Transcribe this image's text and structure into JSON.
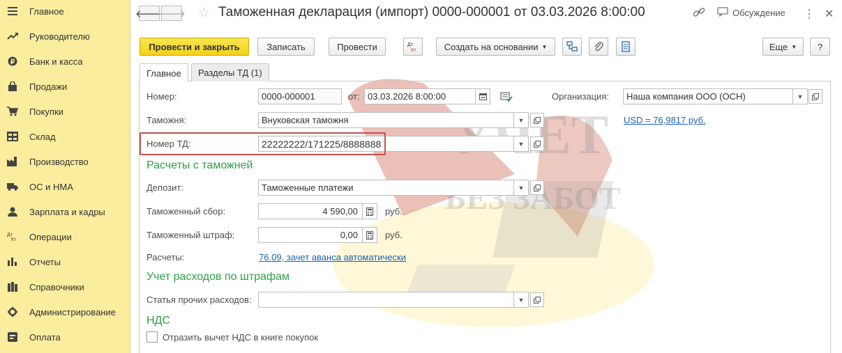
{
  "sidebar": {
    "items": [
      {
        "label": "Главное",
        "icon": "menu-icon"
      },
      {
        "label": "Руководителю",
        "icon": "trend-icon"
      },
      {
        "label": "Банк и касса",
        "icon": "coin-icon"
      },
      {
        "label": "Продажи",
        "icon": "bag-icon"
      },
      {
        "label": "Покупки",
        "icon": "cart-icon"
      },
      {
        "label": "Склад",
        "icon": "warehouse-icon"
      },
      {
        "label": "Производство",
        "icon": "factory-icon"
      },
      {
        "label": "ОС и НМА",
        "icon": "truck-icon"
      },
      {
        "label": "Зарплата и кадры",
        "icon": "person-icon"
      },
      {
        "label": "Операции",
        "icon": "dt-kt-icon"
      },
      {
        "label": "Отчеты",
        "icon": "bar-chart-icon"
      },
      {
        "label": "Справочники",
        "icon": "books-icon"
      },
      {
        "label": "Администрирование",
        "icon": "gear-icon"
      },
      {
        "label": "Оплата",
        "icon": "payment-icon"
      }
    ]
  },
  "window": {
    "title": "Таможенная декларация (импорт) 0000-000001 от 03.03.2026 8:00:00",
    "discussion_label": "Обсуждение"
  },
  "toolbar": {
    "post_close_label": "Провести и закрыть",
    "save_label": "Записать",
    "post_label": "Провести",
    "dtkt_label": "Дт\nКт",
    "create_based_label": "Создать на основании",
    "more_label": "Еще",
    "help_label": "?"
  },
  "tabs": [
    {
      "label": "Главное",
      "active": true
    },
    {
      "label": "Разделы ТД (1)",
      "active": false
    }
  ],
  "form": {
    "number_label": "Номер:",
    "number_value": "0000-000001",
    "date_label": "от:",
    "date_value": "03.03.2026  8:00:00",
    "org_label": "Организация:",
    "org_value": "Наша компания ООО (ОСН)",
    "currency_rate": "USD = 76,9817 руб.",
    "customs_label": "Таможня:",
    "customs_value": "Внуковская таможня",
    "td_number_label": "Номер ТД:",
    "td_number_value": "22222222/171225/8888888",
    "section_customs": "Расчеты с таможней",
    "deposit_label": "Депозит:",
    "deposit_value": "Таможенные платежи",
    "fee_label": "Таможенный сбор:",
    "fee_value": "4 590,00",
    "fee_unit": "руб.",
    "fine_label": "Таможенный штраф:",
    "fine_value": "0,00",
    "fine_unit": "руб.",
    "settlements_label": "Расчеты:",
    "settlements_value": "76.09, зачет аванса автоматически",
    "section_fines": "Учет расходов по штрафам",
    "other_expenses_label": "Статья прочих расходов:",
    "other_expenses_value": "",
    "section_vat": "НДС",
    "vat_checkbox_label": "Отразить вычет НДС в книге покупок",
    "vat_checkbox_checked": false
  },
  "watermark": {
    "line1": "УЧЕТ",
    "line2": "БЕЗ ЗАБОТ"
  },
  "colors": {
    "sidebar_bg": "#fbed9e",
    "primary_button": "#f2d21a",
    "section_green": "#2fa043",
    "link_blue": "#1c63b6",
    "highlight_red": "#c0504d"
  }
}
